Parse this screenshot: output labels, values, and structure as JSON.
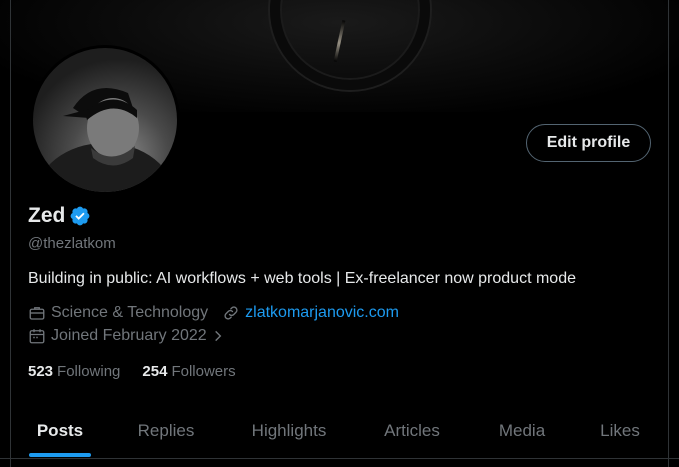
{
  "profile": {
    "name": "Zed",
    "handle": "@thezlatkom",
    "bio": "Building in public: AI workflows + web tools | Ex-freelancer now product mode",
    "category": "Science & Technology",
    "website": "zlatkomarjanovic.com",
    "joined": "Joined February 2022",
    "edit_profile_label": "Edit profile",
    "verified": true
  },
  "stats": {
    "following_count": "523",
    "following_label": "Following",
    "followers_count": "254",
    "followers_label": "Followers"
  },
  "tabs": [
    {
      "label": "Posts",
      "active": true
    },
    {
      "label": "Replies",
      "active": false
    },
    {
      "label": "Highlights",
      "active": false
    },
    {
      "label": "Articles",
      "active": false
    },
    {
      "label": "Media",
      "active": false
    },
    {
      "label": "Likes",
      "active": false
    }
  ],
  "colors": {
    "background": "#000000",
    "accent": "#1d9bf0",
    "text_primary": "#e7e9ea",
    "text_secondary": "#71767b",
    "border": "#2f3336"
  },
  "icons": {
    "category": "briefcase-icon",
    "website": "link-icon",
    "joined": "calendar-icon",
    "verified": "verified-badge-icon",
    "more": "chevron-right-icon"
  }
}
